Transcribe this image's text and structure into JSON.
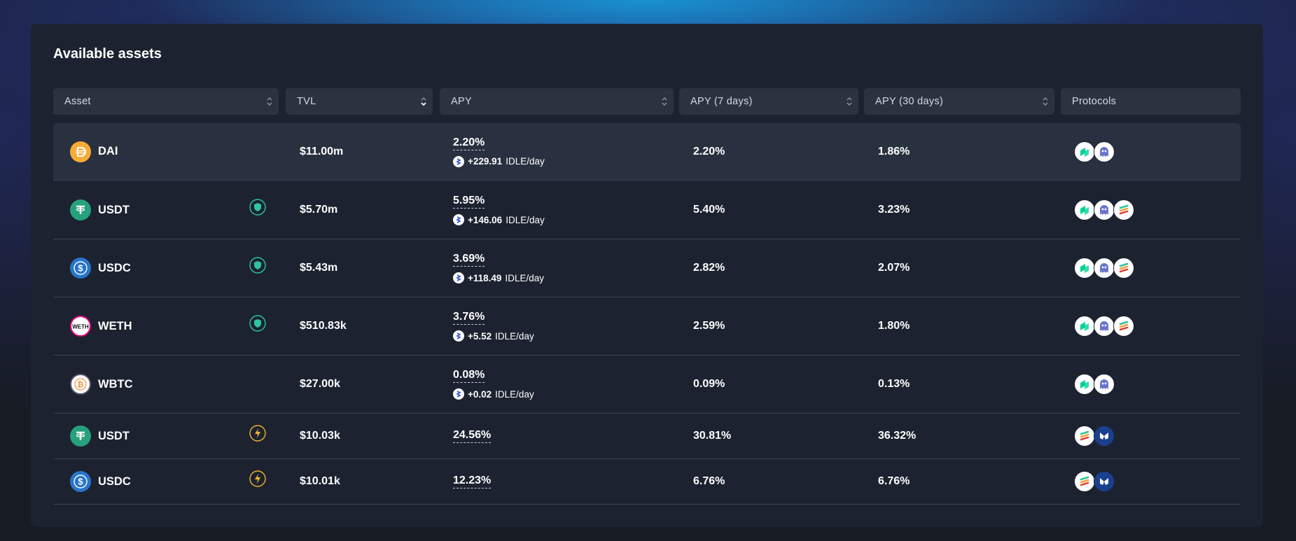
{
  "title": "Available assets",
  "columns": [
    "Asset",
    "TVL",
    "APY",
    "APY (7 days)",
    "APY (30 days)",
    "Protocols"
  ],
  "idle_unit": "IDLE/day",
  "rows": [
    {
      "asset": "DAI",
      "tvl": "$11.00m",
      "apy": "2.20%",
      "idle": "+229.91",
      "apy7": "2.20%",
      "apy30": "1.86%",
      "badge": "none",
      "protocols": [
        "compound-icon",
        "aave-icon"
      ]
    },
    {
      "asset": "USDT",
      "tvl": "$5.70m",
      "apy": "5.95%",
      "idle": "+146.06",
      "apy7": "5.40%",
      "apy30": "3.23%",
      "badge": "shield-icon",
      "protocols": [
        "compound-icon",
        "aave-icon",
        "clearpool-icon"
      ]
    },
    {
      "asset": "USDC",
      "tvl": "$5.43m",
      "apy": "3.69%",
      "idle": "+118.49",
      "apy7": "2.82%",
      "apy30": "2.07%",
      "badge": "shield-icon",
      "protocols": [
        "compound-icon",
        "aave-icon",
        "clearpool-icon"
      ]
    },
    {
      "asset": "WETH",
      "tvl": "$510.83k",
      "apy": "3.76%",
      "idle": "+5.52",
      "apy7": "2.59%",
      "apy30": "1.80%",
      "badge": "shield-icon",
      "protocols": [
        "compound-icon",
        "aave-icon",
        "clearpool-icon"
      ]
    },
    {
      "asset": "WBTC",
      "tvl": "$27.00k",
      "apy": "0.08%",
      "idle": "+0.02",
      "apy7": "0.09%",
      "apy30": "0.13%",
      "badge": "none",
      "protocols": [
        "compound-icon",
        "aave-icon"
      ]
    },
    {
      "asset": "USDT",
      "tvl": "$10.03k",
      "apy": "24.56%",
      "idle": "",
      "apy7": "30.81%",
      "apy30": "36.32%",
      "badge": "lightning-icon",
      "protocols": [
        "clearpool-icon",
        "morpho-icon"
      ]
    },
    {
      "asset": "USDC",
      "tvl": "$10.01k",
      "apy": "12.23%",
      "idle": "",
      "apy7": "6.76%",
      "apy30": "6.76%",
      "badge": "lightning-icon",
      "protocols": [
        "clearpool-icon",
        "morpho-icon"
      ]
    }
  ],
  "colors": {
    "panel": "#1c2230",
    "header_bg": "#2b3341",
    "selected_row": "#293140",
    "shield_badge": "#2ec4a0",
    "lightning_badge": "#f0b429"
  }
}
